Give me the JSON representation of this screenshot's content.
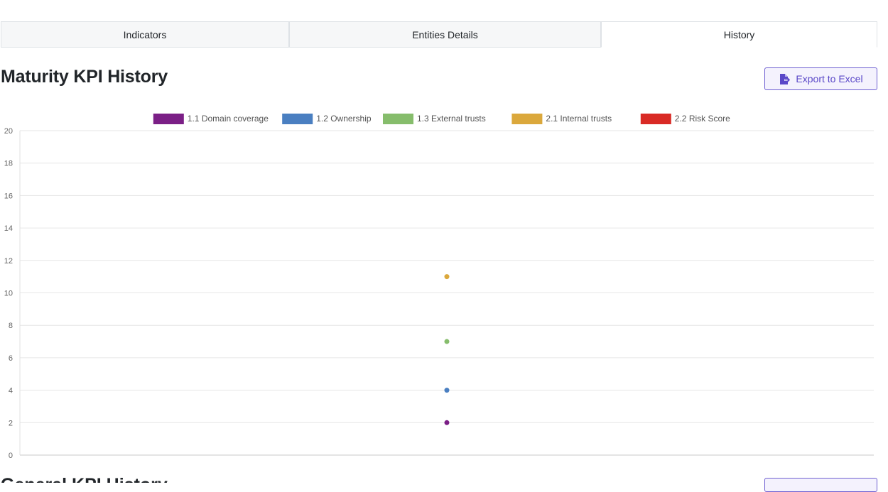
{
  "tabs": [
    {
      "label": "Indicators",
      "active": false
    },
    {
      "label": "Entities Details",
      "active": false
    },
    {
      "label": "History",
      "active": true
    }
  ],
  "section": {
    "title": "Maturity KPI History",
    "export_label": "Export to Excel",
    "export_icon": "file-export-icon"
  },
  "chart_data": {
    "type": "scatter",
    "title": "",
    "xlabel": "",
    "ylabel": "",
    "ylim": [
      0,
      20
    ],
    "yticks": [
      0,
      2,
      4,
      6,
      8,
      10,
      12,
      14,
      16,
      18,
      20
    ],
    "grid": true,
    "legend_position": "top-center",
    "series": [
      {
        "name": "1.1 Domain coverage",
        "color": "#7b1f86",
        "values": [
          2
        ]
      },
      {
        "name": "1.2 Ownership",
        "color": "#4a7fc1",
        "values": [
          4
        ]
      },
      {
        "name": "1.3 External trusts",
        "color": "#86bd6c",
        "values": [
          7
        ]
      },
      {
        "name": "2.1 Internal trusts",
        "color": "#dba83c",
        "values": [
          11
        ]
      },
      {
        "name": "2.2 Risk Score",
        "color": "#d92a25",
        "values": [
          null
        ]
      }
    ]
  },
  "second_section": {
    "title": "General KPI History"
  }
}
